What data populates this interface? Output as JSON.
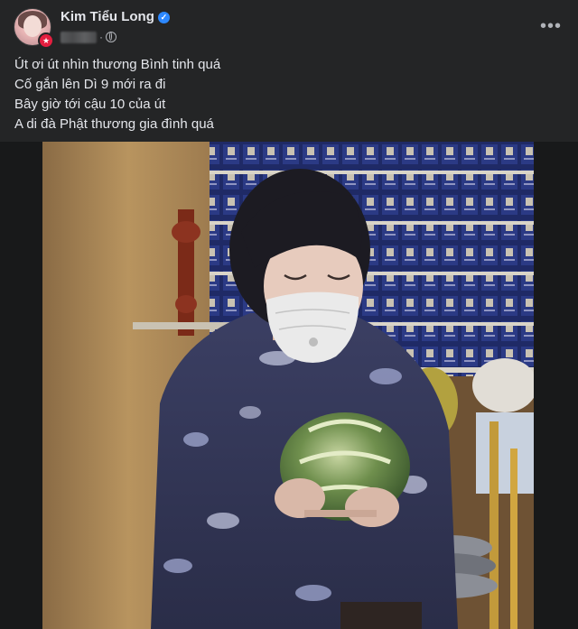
{
  "post": {
    "author": {
      "name": "Kim Tiểu Long",
      "verified": true,
      "badge_icon": "live-badge-icon"
    },
    "privacy_icon": "globe-icon",
    "menu_icon": "more-horizontal-icon",
    "menu_label": "•••",
    "text_lines": [
      "Út ơi út nhìn thương Bình tinh quá",
      "Cố gắn lên Dì 9 mới ra đi",
      "Bây giờ tới cậu 10 của út",
      "A di đà Phật thương gia đình quá"
    ],
    "photo": {
      "content": "woman-in-mask-holding-urn"
    }
  },
  "colors": {
    "background": "#242526",
    "text_primary": "#e4e6eb",
    "text_secondary": "#b0b3b8",
    "verified_blue": "#2d88ff",
    "badge_red": "#e41e3f"
  }
}
